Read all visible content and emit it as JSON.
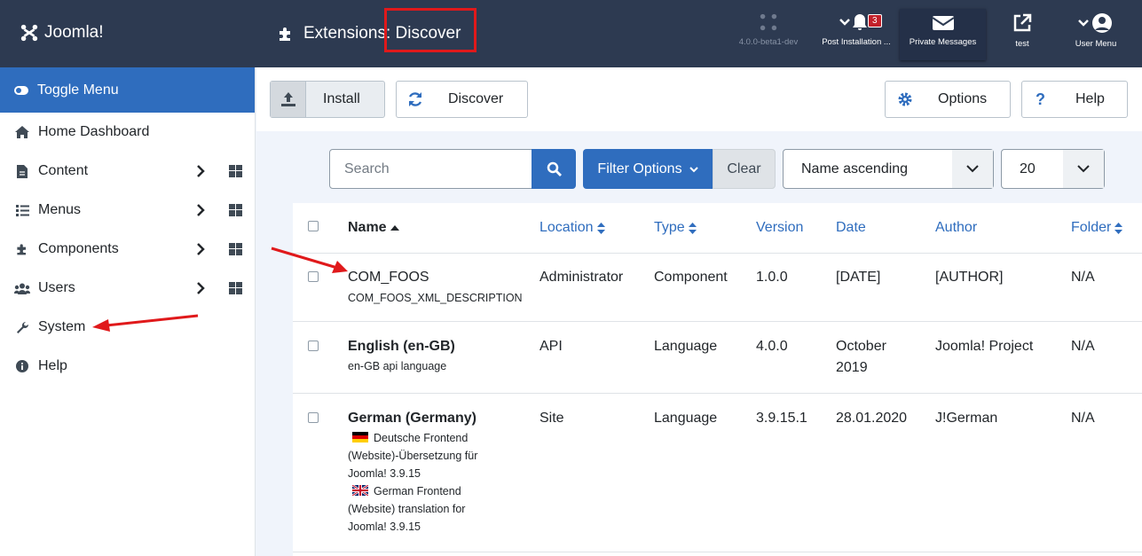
{
  "header": {
    "logo_text": "Joomla!",
    "page_title": "Extensions: Discover",
    "version_label": "4.0.0-beta1-dev",
    "post_installation_label": "Post Installation ...",
    "post_installation_badge": "3",
    "private_messages_label": "Private Messages",
    "site_label": "test",
    "user_menu_label": "User Menu"
  },
  "sidebar": {
    "toggle_label": "Toggle Menu",
    "items": [
      {
        "label": "Home Dashboard",
        "icon": "home-icon"
      },
      {
        "label": "Content",
        "icon": "file-icon"
      },
      {
        "label": "Menus",
        "icon": "list-icon"
      },
      {
        "label": "Components",
        "icon": "puzzle-icon"
      },
      {
        "label": "Users",
        "icon": "users-icon"
      },
      {
        "label": "System",
        "icon": "wrench-icon"
      },
      {
        "label": "Help",
        "icon": "info-icon"
      }
    ]
  },
  "toolbar": {
    "install_label": "Install",
    "discover_label": "Discover",
    "options_label": "Options",
    "help_label": "Help"
  },
  "filters": {
    "search_placeholder": "Search",
    "filter_options_label": "Filter Options",
    "clear_label": "Clear",
    "ordering_value": "Name ascending",
    "limit_value": "20"
  },
  "table": {
    "columns": {
      "name": "Name",
      "location": "Location",
      "type": "Type",
      "version": "Version",
      "date": "Date",
      "author": "Author",
      "folder": "Folder"
    },
    "rows": [
      {
        "name": "COM_FOOS",
        "description": "COM_FOOS_XML_DESCRIPTION",
        "location": "Administrator",
        "type": "Component",
        "version": "1.0.0",
        "date": "[DATE]",
        "author": "[AUTHOR]",
        "folder": "N/A"
      },
      {
        "name": "English (en-GB)",
        "description": "en-GB api language",
        "location": "API",
        "type": "Language",
        "version": "4.0.0",
        "date_line1": "October",
        "date_line2": "2019",
        "author": "Joomla! Project",
        "folder": "N/A"
      },
      {
        "name": "German (Germany)",
        "desc_de_line1": "Deutsche Frontend",
        "desc_de_line2": "(Website)-Übersetzung für",
        "desc_de_line3": "Joomla! 3.9.15",
        "desc_en_line1": "German Frontend",
        "desc_en_line2": "(Website) translation for",
        "desc_en_line3": "Joomla! 3.9.15",
        "location": "Site",
        "type": "Language",
        "version": "3.9.15.1",
        "date": "28.01.2020",
        "author": "J!German",
        "folder": "N/A"
      }
    ]
  },
  "colors": {
    "header_bg": "#2d3a51",
    "primary": "#2f6dbe",
    "annotation_red": "#e0191b"
  }
}
